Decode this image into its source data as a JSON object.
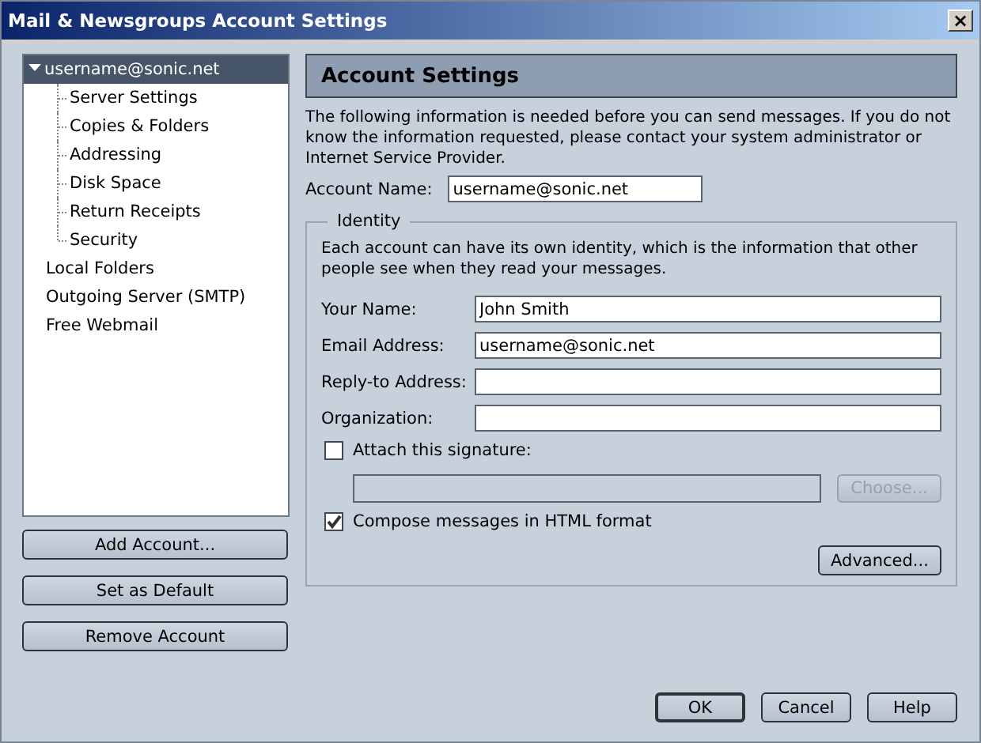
{
  "window": {
    "title": "Mail & Newsgroups Account Settings",
    "close": "×"
  },
  "tree": [
    {
      "label": "username@sonic.net",
      "selected": true,
      "expanded": true,
      "children": [
        {
          "label": "Server Settings",
          "selected": false
        },
        {
          "label": "Copies & Folders",
          "selected": false
        },
        {
          "label": "Addressing",
          "selected": false
        },
        {
          "label": "Disk Space",
          "selected": false
        },
        {
          "label": "Return Receipts",
          "selected": false
        },
        {
          "label": "Security",
          "selected": false
        }
      ]
    },
    {
      "label": "Local Folders",
      "selected": false
    },
    {
      "label": "Outgoing Server (SMTP)",
      "selected": false
    },
    {
      "label": "Free Webmail",
      "selected": false
    }
  ],
  "account_buttons": [
    "Add Account...",
    "Set as Default",
    "Remove Account"
  ],
  "panel": {
    "title": "Account Settings",
    "intro": "The following information is needed before you can send messages. If you do not know the information requested, please contact your system administrator or Internet Service Provider.",
    "account_name": {
      "label": "Account Name:",
      "value": "username@sonic.net"
    },
    "identity": {
      "legend": "Identity",
      "description": "Each account can have its own identity, which is the information that other people see when they read your messages.",
      "fields": [
        {
          "label": "Your Name:",
          "value": "John Smith"
        },
        {
          "label": "Email Address:",
          "value": "username@sonic.net"
        },
        {
          "label": "Reply-to Address:"
        },
        {
          "label": "Organization:"
        }
      ],
      "signature": {
        "label": "Attach this signature:",
        "checked": false,
        "choose": "Choose...",
        "disabled": true
      },
      "html_format": {
        "label": "Compose messages in HTML format",
        "checked": true
      },
      "advanced": "Advanced..."
    }
  },
  "buttons": [
    {
      "label": "OK",
      "default": true
    },
    {
      "label": "Cancel",
      "default": false
    },
    {
      "label": "Help",
      "default": false
    }
  ]
}
